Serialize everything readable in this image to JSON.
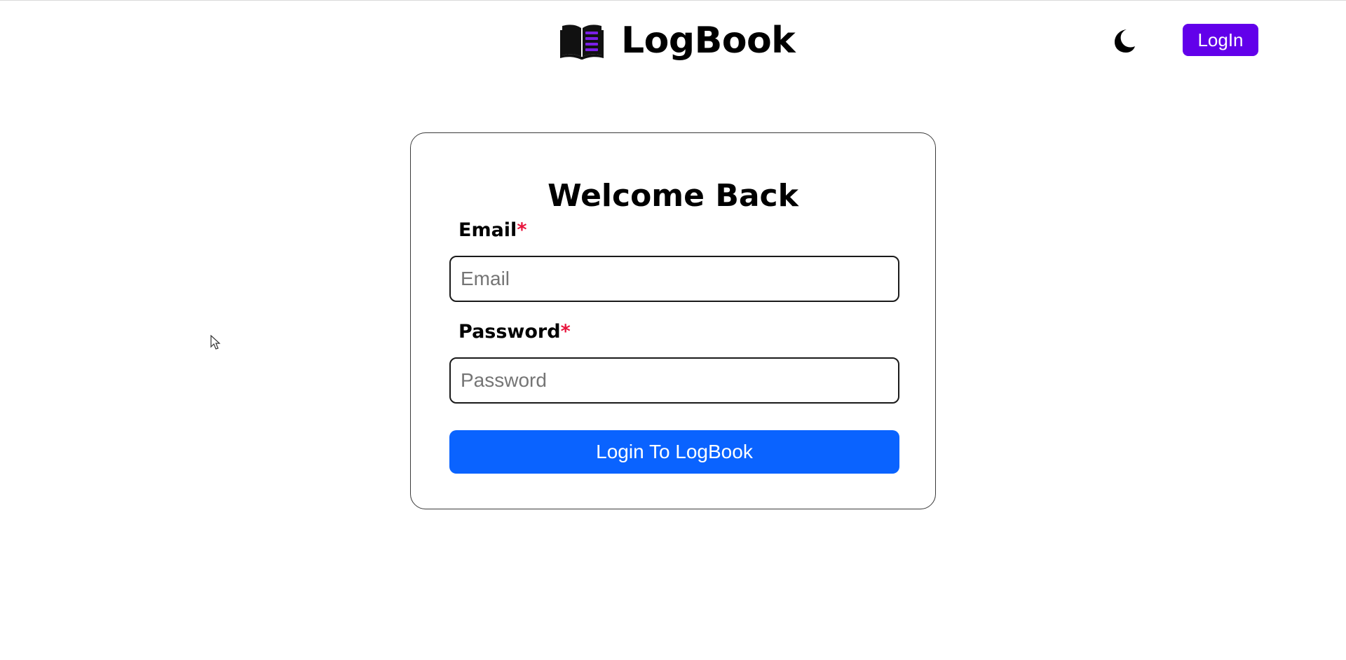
{
  "colors": {
    "accent_purple": "#6200ea",
    "accent_blue": "#0a63ff",
    "required_red": "#e8143c",
    "book_purple": "#7a1fe6"
  },
  "header": {
    "brand_name": "LogBook",
    "brand_icon": "open-book-icon",
    "theme_toggle_icon": "moon-icon",
    "login_label": "LogIn"
  },
  "form": {
    "title": "Welcome Back",
    "email": {
      "label": "Email",
      "required_mark": "*",
      "placeholder": "Email",
      "value": ""
    },
    "password": {
      "label": "Password",
      "required_mark": "*",
      "placeholder": "Password",
      "value": ""
    },
    "submit_label": "Login To LogBook"
  }
}
